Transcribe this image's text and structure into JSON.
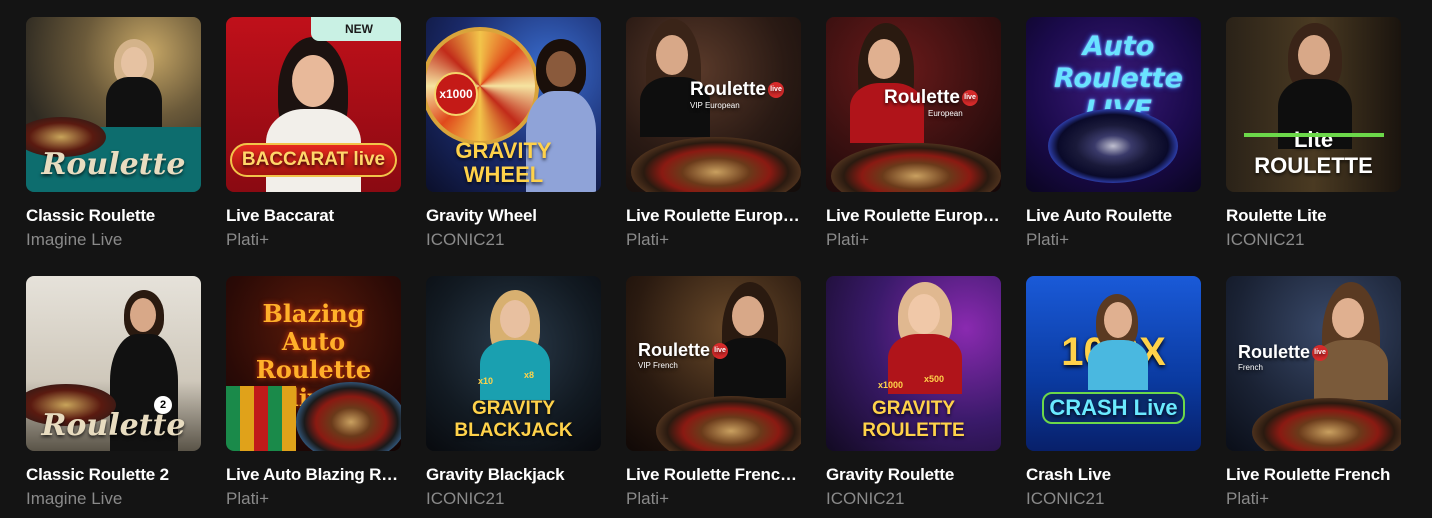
{
  "games": [
    {
      "title": "Classic Roulette",
      "provider": "Imagine Live",
      "logo": "Roulette",
      "badge": ""
    },
    {
      "title": "Live Baccarat",
      "provider": "Plati+",
      "logo": "BACCARAT live",
      "badge": "NEW"
    },
    {
      "title": "Gravity Wheel",
      "provider": "ICONIC21",
      "logo": "GRAVITY WHEEL",
      "badge": ""
    },
    {
      "title": "Live Roulette Europ…",
      "provider": "Plati+",
      "logo": "Roulette",
      "logo_sub": "VIP European",
      "badge": ""
    },
    {
      "title": "Live Roulette Europ…",
      "provider": "Plati+",
      "logo": "Roulette",
      "logo_sub": "European",
      "badge": ""
    },
    {
      "title": "Live Auto Roulette",
      "provider": "Plati+",
      "logo": "Auto Roulette LIVE",
      "badge": ""
    },
    {
      "title": "Roulette Lite",
      "provider": "ICONIC21",
      "logo": "Lite ROULETTE",
      "badge": ""
    },
    {
      "title": "Classic Roulette 2",
      "provider": "Imagine Live",
      "logo": "Roulette",
      "badge": ""
    },
    {
      "title": "Live Auto Blazing R…",
      "provider": "Plati+",
      "logo": "Blazing Auto Roulette live",
      "badge": ""
    },
    {
      "title": "Gravity Blackjack",
      "provider": "ICONIC21",
      "logo": "GRAVITY BLACKJACK",
      "badge": ""
    },
    {
      "title": "Live Roulette French…",
      "provider": "Plati+",
      "logo": "Roulette",
      "logo_sub": "VIP French",
      "badge": ""
    },
    {
      "title": "Gravity Roulette",
      "provider": "ICONIC21",
      "logo": "GRAVITY ROULETTE",
      "badge": ""
    },
    {
      "title": "Crash Live",
      "provider": "ICONIC21",
      "logo": "CRASH Live",
      "badge": ""
    },
    {
      "title": "Live Roulette French",
      "provider": "Plati+",
      "logo": "Roulette",
      "logo_sub": "French",
      "badge": ""
    }
  ],
  "misc": {
    "x1000": "x1000",
    "x500": "x500",
    "x10": "x10",
    "x8": "x8",
    "n2": "2",
    "tenx": "10 0X",
    "live_tag": "live"
  }
}
